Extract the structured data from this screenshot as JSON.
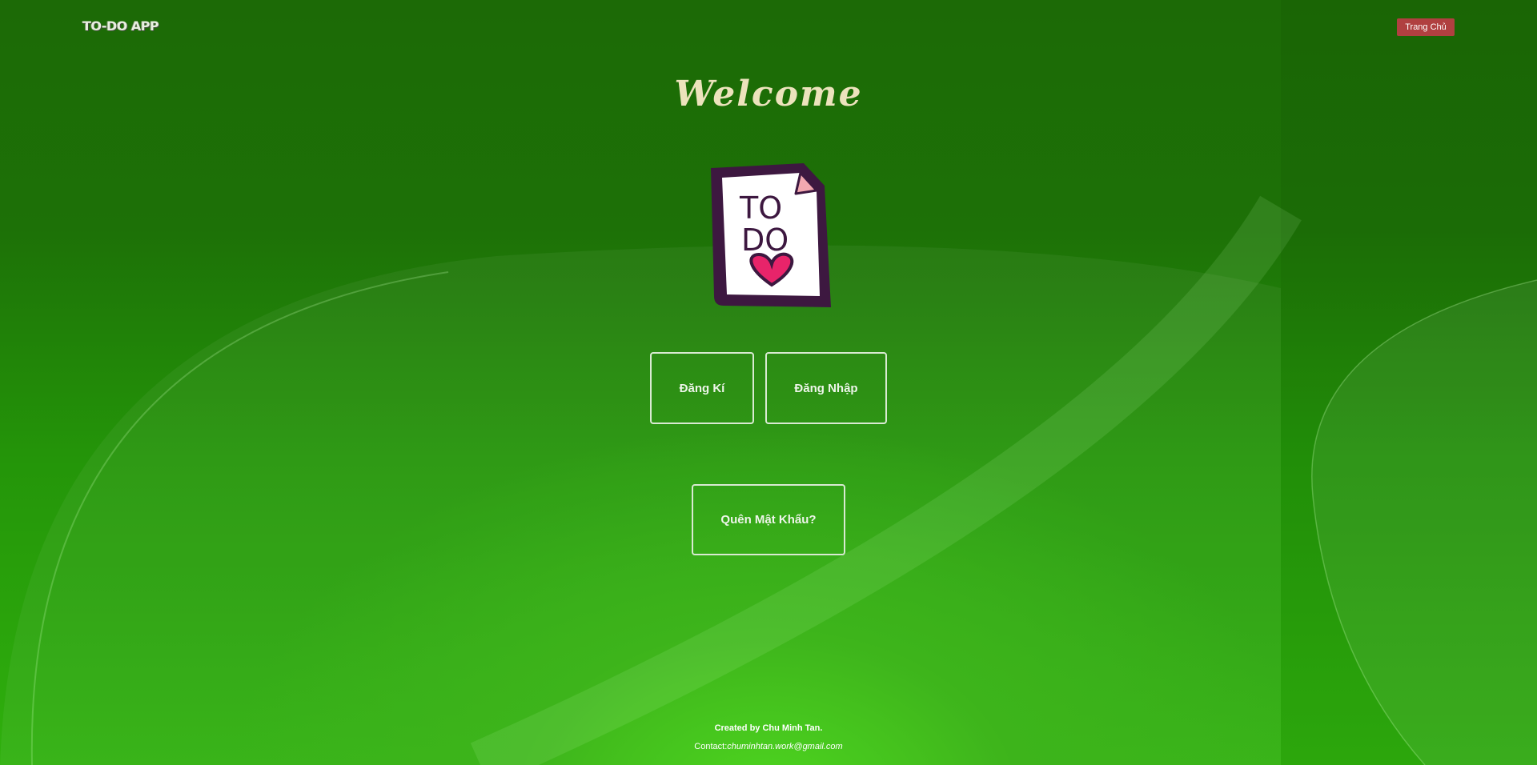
{
  "header": {
    "logo_text": "TO-DO APP",
    "home_button_label": "Trang Chủ"
  },
  "main": {
    "welcome_title": "Welcome",
    "todo_image_text_line1": "TO",
    "todo_image_text_line2": "DO",
    "register_button_label": "Đăng Kí",
    "login_button_label": "Đăng Nhập",
    "forgot_password_button_label": "Quên Mật Khẩu?"
  },
  "footer": {
    "created_by": "Created by Chu Minh Tan.",
    "contact_label": "Contact:",
    "contact_email": "chuminhtan.work@gmail.com"
  },
  "colors": {
    "home_button": "#b04040",
    "welcome_text": "#ece3bc",
    "heart": "#e8246a",
    "note_border": "#3d1840",
    "fold": "#f2a8b0"
  }
}
